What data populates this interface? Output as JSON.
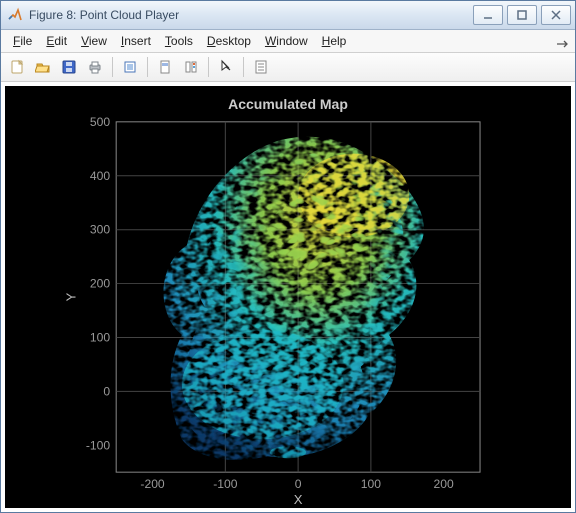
{
  "window": {
    "title": "Figure 8: Point Cloud Player"
  },
  "menu": {
    "items": [
      {
        "u": "F",
        "rest": "ile"
      },
      {
        "u": "E",
        "rest": "dit"
      },
      {
        "u": "V",
        "rest": "iew"
      },
      {
        "u": "I",
        "rest": "nsert"
      },
      {
        "u": "T",
        "rest": "ools"
      },
      {
        "u": "D",
        "rest": "esktop"
      },
      {
        "u": "W",
        "rest": "indow"
      },
      {
        "u": "H",
        "rest": "elp"
      }
    ]
  },
  "plot": {
    "title": "Accumulated Map",
    "xlabel": "X",
    "ylabel": "Y",
    "x_ticks": [
      -200,
      -100,
      0,
      100,
      200
    ],
    "y_ticks": [
      -100,
      0,
      100,
      200,
      300,
      400,
      500
    ]
  },
  "chart_data": {
    "type": "scatter",
    "title": "Accumulated Map",
    "xlabel": "X",
    "ylabel": "Y",
    "xlim": [
      -250,
      250
    ],
    "ylim": [
      -150,
      500
    ],
    "note": "Dense aerial LiDAR point cloud of an urban area, parula-style coloring by elevation. Cluster extent roughly x:[-160,180], y:[-120,470].",
    "clusters": [
      {
        "x": [
          -160,
          180
        ],
        "y": [
          -120,
          470
        ],
        "density": "high",
        "color_low": "#0b3d6e",
        "color_mid": "#26c2c2",
        "color_high": "#e6da3a"
      }
    ]
  }
}
